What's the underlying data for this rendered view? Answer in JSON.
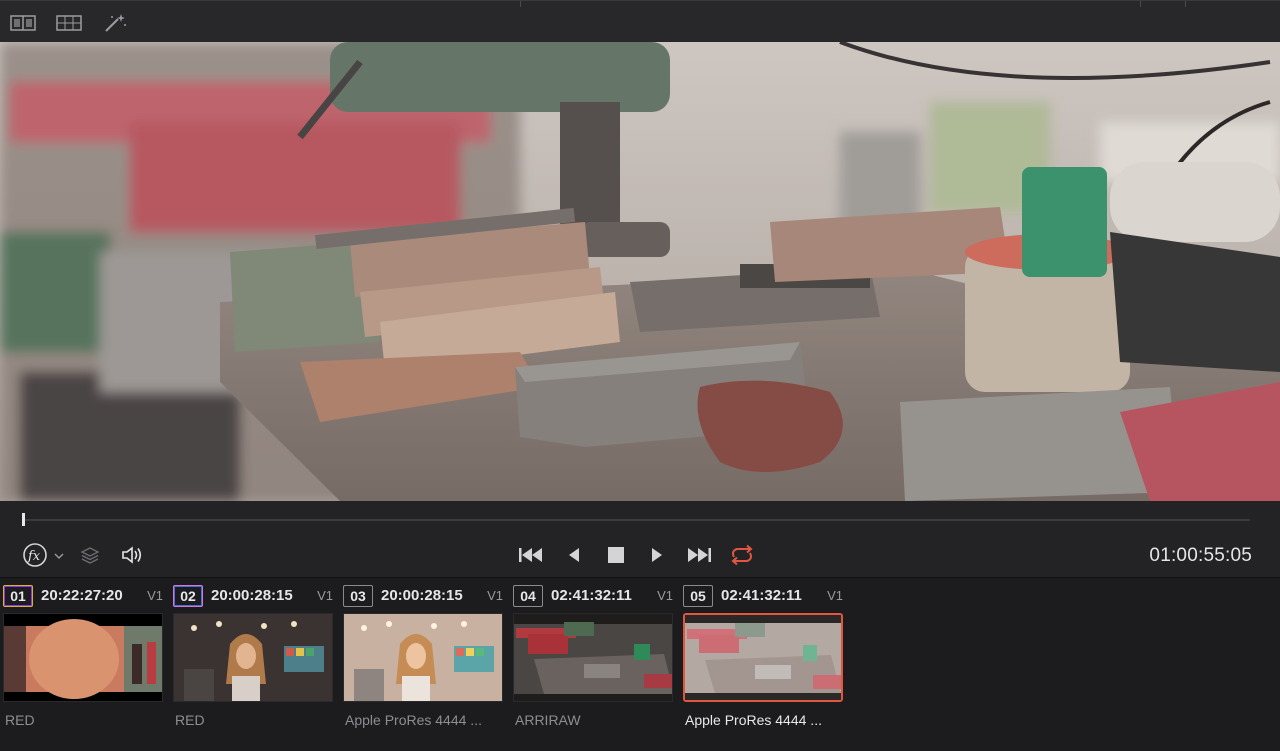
{
  "toolbar": {
    "icons": [
      "compare-view-icon",
      "grid-view-icon",
      "magic-wand-icon"
    ]
  },
  "playback": {
    "timecode": "01:00:55:05",
    "loop_active": true,
    "loop_color": "#e0573f"
  },
  "clips": [
    {
      "number": "01",
      "timecode": "20:22:27:20",
      "track": "V1",
      "codec": "RED",
      "selected": false
    },
    {
      "number": "02",
      "timecode": "20:00:28:15",
      "track": "V1",
      "codec": "RED",
      "selected": false
    },
    {
      "number": "03",
      "timecode": "20:00:28:15",
      "track": "V1",
      "codec": "Apple ProRes 4444 ...",
      "selected": false
    },
    {
      "number": "04",
      "timecode": "02:41:32:11",
      "track": "V1",
      "codec": "ARRIRAW",
      "selected": false
    },
    {
      "number": "05",
      "timecode": "02:41:32:11",
      "track": "V1",
      "codec": "Apple ProRes 4444 ...",
      "selected": true
    }
  ],
  "colors": {
    "selection": "#e0573f",
    "panel": "#232326",
    "toolbar": "#28282b"
  }
}
